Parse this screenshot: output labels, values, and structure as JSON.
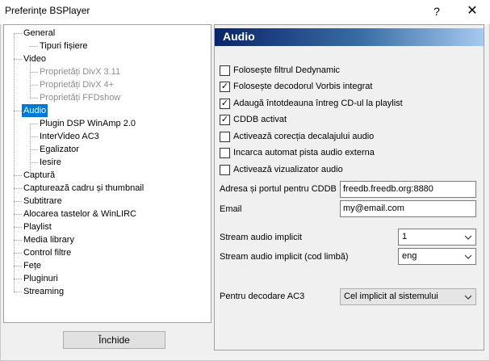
{
  "window": {
    "title": "Preferințe BSPlayer",
    "help": "?",
    "close": "✕"
  },
  "tree": [
    {
      "label": "General",
      "disabled": false,
      "selected": false
    },
    {
      "label": "Tipuri fișiere",
      "disabled": false,
      "selected": false
    },
    {
      "label": "Video",
      "disabled": false,
      "selected": false
    },
    {
      "label": "Proprietăți DivX 3.11",
      "disabled": true,
      "selected": false
    },
    {
      "label": "Proprietăți DivX 4+",
      "disabled": true,
      "selected": false
    },
    {
      "label": "Proprietăți FFDshow",
      "disabled": true,
      "selected": false
    },
    {
      "label": "Audio",
      "disabled": false,
      "selected": true
    },
    {
      "label": "Plugin DSP WinAmp 2.0",
      "disabled": false,
      "selected": false
    },
    {
      "label": "InterVideo AC3",
      "disabled": false,
      "selected": false
    },
    {
      "label": "Egalizator",
      "disabled": false,
      "selected": false
    },
    {
      "label": "Iesire",
      "disabled": false,
      "selected": false
    },
    {
      "label": "Captură",
      "disabled": false,
      "selected": false
    },
    {
      "label": "Capturează cadru și thumbnail",
      "disabled": false,
      "selected": false
    },
    {
      "label": "Subtitrare",
      "disabled": false,
      "selected": false
    },
    {
      "label": "Alocarea tastelor & WinLIRC",
      "disabled": false,
      "selected": false
    },
    {
      "label": "Playlist",
      "disabled": false,
      "selected": false
    },
    {
      "label": "Media library",
      "disabled": false,
      "selected": false
    },
    {
      "label": "Control filtre",
      "disabled": false,
      "selected": false
    },
    {
      "label": "Fețe",
      "disabled": false,
      "selected": false
    },
    {
      "label": "Pluginuri",
      "disabled": false,
      "selected": false
    },
    {
      "label": "Streaming",
      "disabled": false,
      "selected": false
    }
  ],
  "close_button": "Închide",
  "panel": {
    "header": "Audio",
    "checkboxes": [
      {
        "label": "Folosește filtrul Dedynamic",
        "checked": false
      },
      {
        "label": "Folosește decodorul Vorbis integrat",
        "checked": true
      },
      {
        "label": "Adaugă întotdeauna întreg CD-ul la playlist",
        "checked": true
      },
      {
        "label": "CDDB activat",
        "checked": true
      },
      {
        "label": "Activează corecția decalajului audio",
        "checked": false
      },
      {
        "label": "Incarca automat pista audio externa",
        "checked": false
      },
      {
        "label": "Activează vizualizator audio",
        "checked": false
      }
    ],
    "cddb": {
      "label": "Adresa și portul pentru CDDB",
      "value": "freedb.freedb.org:8880"
    },
    "email": {
      "label": "Email",
      "value": "my@email.com"
    },
    "stream_default": {
      "label": "Stream audio implicit",
      "value": "1"
    },
    "stream_lang": {
      "label": "Stream audio implicit (cod limbă)",
      "value": "eng"
    },
    "ac3": {
      "label": "Pentru decodare AC3",
      "value": "Cel implicit al sistemului"
    }
  }
}
